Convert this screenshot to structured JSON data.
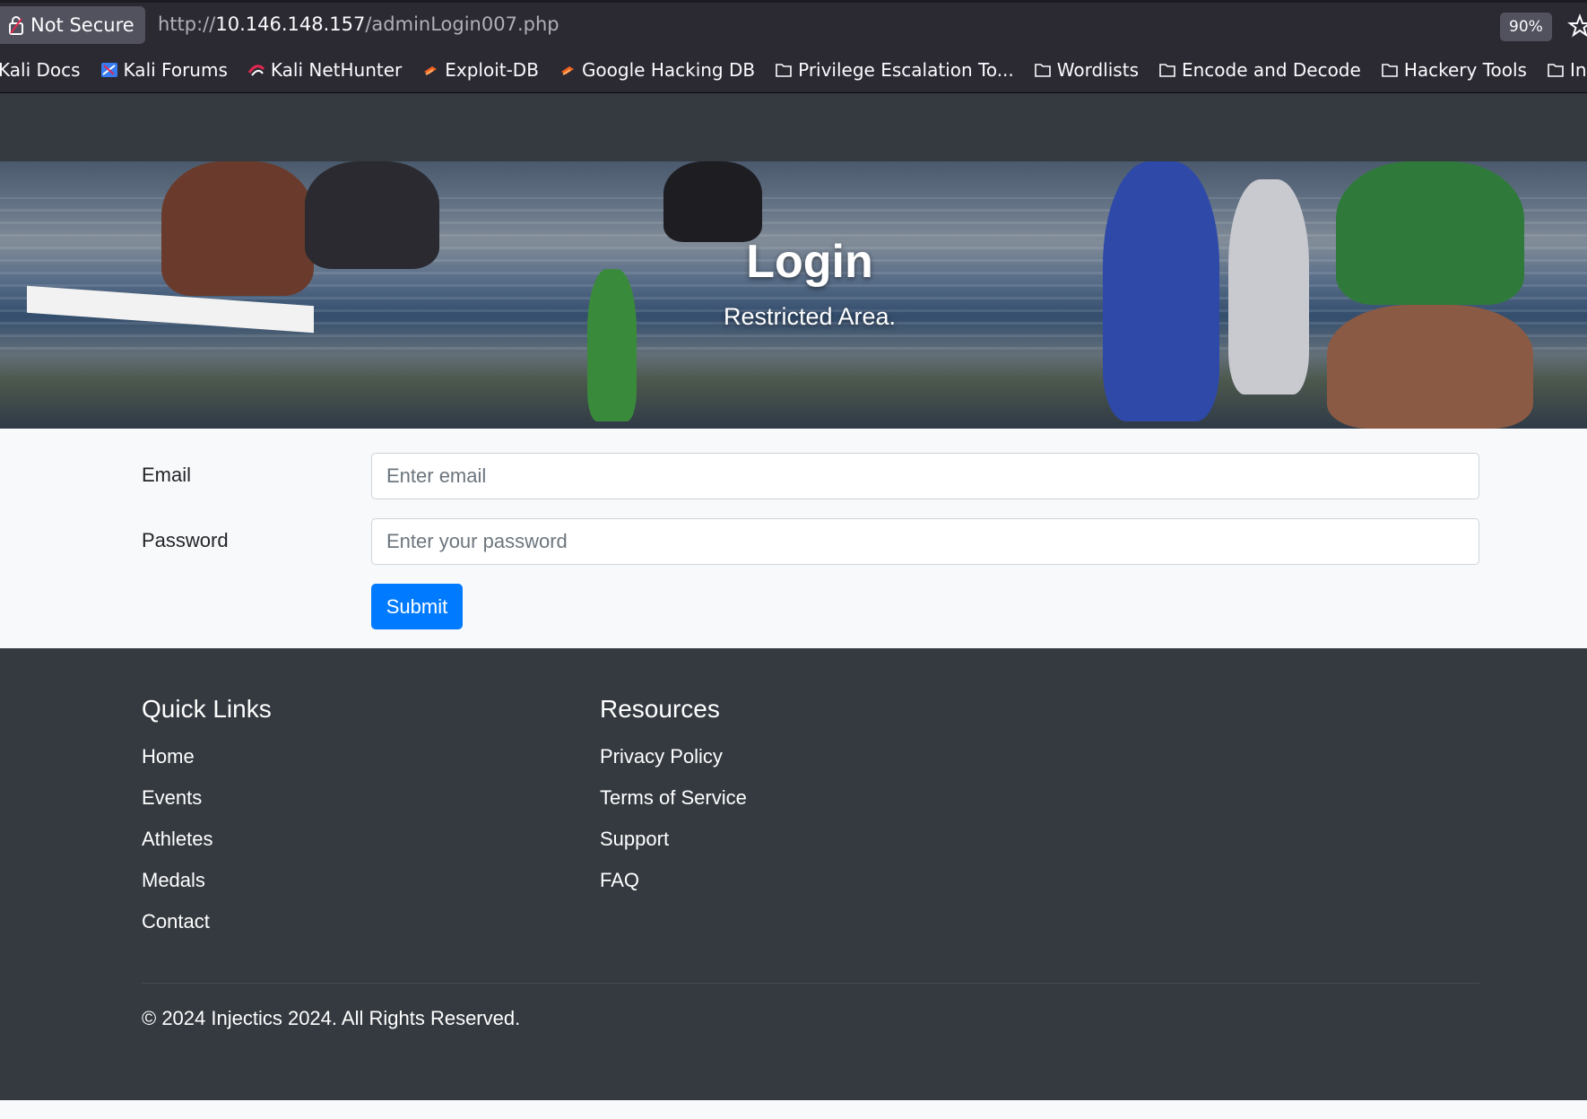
{
  "browser": {
    "security_label": "Not Secure",
    "url_scheme": "http://",
    "url_host": "10.146.148.157",
    "url_path": "/adminLogin007.php",
    "zoom": "90%"
  },
  "bookmarks": [
    {
      "label": "Kali Docs",
      "icon": "none"
    },
    {
      "label": "Kali Forums",
      "icon": "kali-icon"
    },
    {
      "label": "Kali NetHunter",
      "icon": "nethunter-icon"
    },
    {
      "label": "Exploit-DB",
      "icon": "exploitdb-icon"
    },
    {
      "label": "Google Hacking DB",
      "icon": "exploitdb-icon"
    },
    {
      "label": "Privilege Escalation To...",
      "icon": "folder-icon"
    },
    {
      "label": "Wordlists",
      "icon": "folder-icon"
    },
    {
      "label": "Encode and Decode",
      "icon": "folder-icon"
    },
    {
      "label": "Hackery Tools",
      "icon": "folder-icon"
    },
    {
      "label": "Inc",
      "icon": "folder-icon"
    }
  ],
  "hero": {
    "title": "Login",
    "subtitle": "Restricted Area."
  },
  "form": {
    "email_label": "Email",
    "email_placeholder": "Enter email",
    "password_label": "Password",
    "password_placeholder": "Enter your password",
    "submit_label": "Submit"
  },
  "footer": {
    "quick_links_title": "Quick Links",
    "quick_links": [
      "Home",
      "Events",
      "Athletes",
      "Medals",
      "Contact"
    ],
    "resources_title": "Resources",
    "resources": [
      "Privacy Policy",
      "Terms of Service",
      "Support",
      "FAQ"
    ],
    "copyright": "© 2024 Injectics 2024. All Rights Reserved."
  },
  "colors": {
    "primary": "#007bff",
    "dark": "#343a40",
    "chrome": "#2b2a33"
  }
}
